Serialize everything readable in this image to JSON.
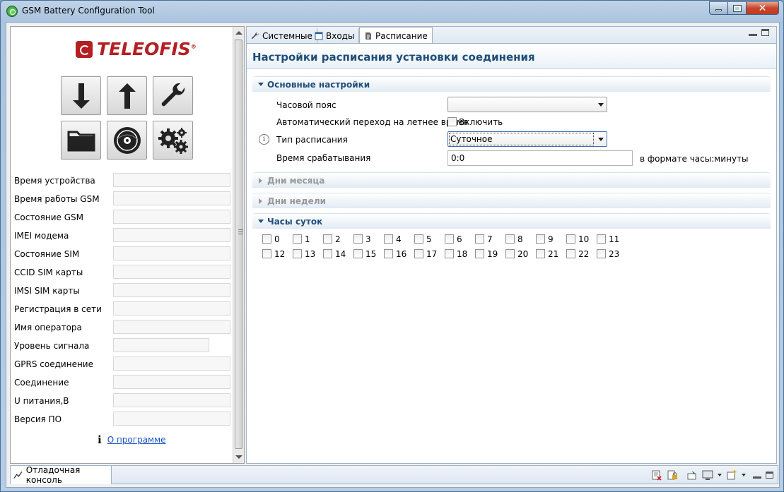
{
  "window": {
    "title": "GSM Battery Configuration Tool"
  },
  "left": {
    "logo_text": "TELEOFIS",
    "logo_reg": "®",
    "toolbar": [
      {
        "name": "download-button",
        "icon": "arrow-down-icon"
      },
      {
        "name": "upload-button",
        "icon": "arrow-up-icon"
      },
      {
        "name": "settings-wrench-button",
        "icon": "wrench-icon"
      },
      {
        "name": "open-folder-button",
        "icon": "folder-icon"
      },
      {
        "name": "disc-button",
        "icon": "disc-icon"
      },
      {
        "name": "gears-button",
        "icon": "gears-icon"
      }
    ],
    "info_rows": [
      {
        "label": "Время устройства",
        "value": ""
      },
      {
        "label": "Время работы GSM",
        "value": ""
      },
      {
        "label": "Состояние GSM",
        "value": ""
      },
      {
        "label": "IMEI модема",
        "value": ""
      },
      {
        "label": "Состояние SIM",
        "value": ""
      },
      {
        "label": "CCID SIM карты",
        "value": ""
      },
      {
        "label": "IMSI SIM карты",
        "value": ""
      },
      {
        "label": "Регистрация в сети",
        "value": ""
      },
      {
        "label": "Имя оператора",
        "value": ""
      },
      {
        "label": "Уровень сигнала",
        "value": ""
      },
      {
        "label": "GPRS соединение",
        "value": ""
      },
      {
        "label": "Соединение",
        "value": ""
      },
      {
        "label": "U питания,В",
        "value": ""
      },
      {
        "label": "Версия ПО",
        "value": ""
      }
    ],
    "about_link": "О программе"
  },
  "tabs": [
    {
      "label": "Системные",
      "icon": "wrench-icon",
      "active": false
    },
    {
      "label": "Входы",
      "icon": "window-icon",
      "active": false
    },
    {
      "label": "Расписание",
      "icon": "document-icon",
      "active": true
    }
  ],
  "form": {
    "title": "Настройки расписания установки соединения",
    "sections": {
      "basic": "Основные настройки",
      "month_days": "Дни месяца",
      "week_days": "Дни недели",
      "day_hours": "Часы суток"
    },
    "timezone": {
      "label": "Часовой пояс",
      "value": ""
    },
    "dst": {
      "label": "Автоматический переход на летнее время",
      "checkbox_label": "Включить",
      "checked": false
    },
    "schedule_type": {
      "label": "Тип расписания",
      "value": "Суточное"
    },
    "trigger_time": {
      "label": "Время срабатывания",
      "value": "0:0",
      "hint": "в формате часы:минуты"
    },
    "hours": [
      "0",
      "1",
      "2",
      "3",
      "4",
      "5",
      "6",
      "7",
      "8",
      "9",
      "10",
      "11",
      "12",
      "13",
      "14",
      "15",
      "16",
      "17",
      "18",
      "19",
      "20",
      "21",
      "22",
      "23"
    ]
  },
  "console": {
    "tab_label": "Отладочная консоль"
  }
}
